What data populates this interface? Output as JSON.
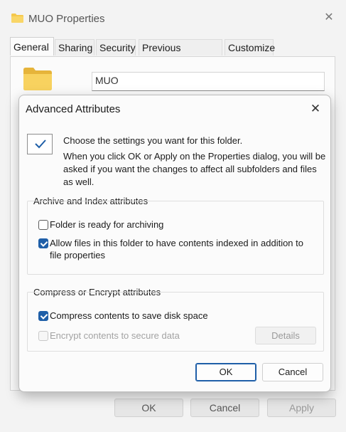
{
  "window": {
    "title": "MUO Properties",
    "close_glyph": "✕",
    "tabs": [
      {
        "label": "General"
      },
      {
        "label": "Sharing"
      },
      {
        "label": "Security"
      },
      {
        "label": "Previous Versions"
      },
      {
        "label": "Customize"
      }
    ],
    "folder_name": "MUO",
    "buttons": {
      "ok": "OK",
      "cancel": "Cancel",
      "apply": "Apply"
    }
  },
  "dialog": {
    "title": "Advanced Attributes",
    "close_glyph": "✕",
    "intro_line1": "Choose the settings you want for this folder.",
    "intro_line2": "When you click OK or Apply on the Properties dialog, you will be asked if you want the changes to affect all subfolders and files as well.",
    "archive_group": {
      "label": "Archive and Index attributes",
      "items": [
        {
          "label": "Folder is ready for archiving",
          "checked": false
        },
        {
          "label": "Allow files in this folder to have contents indexed in addition to file properties",
          "checked": true
        }
      ]
    },
    "compress_group": {
      "label": "Compress or Encrypt attributes",
      "items": [
        {
          "label": "Compress contents to save disk space",
          "checked": true
        },
        {
          "label": "Encrypt contents to secure data",
          "checked": false,
          "disabled": true
        }
      ],
      "details_label": "Details"
    },
    "buttons": {
      "ok": "OK",
      "cancel": "Cancel"
    }
  },
  "colors": {
    "accent": "#1f5fa8",
    "folder": "#f5c84c"
  },
  "icons": [
    "folder-icon",
    "close-icon",
    "checkmark-icon"
  ]
}
